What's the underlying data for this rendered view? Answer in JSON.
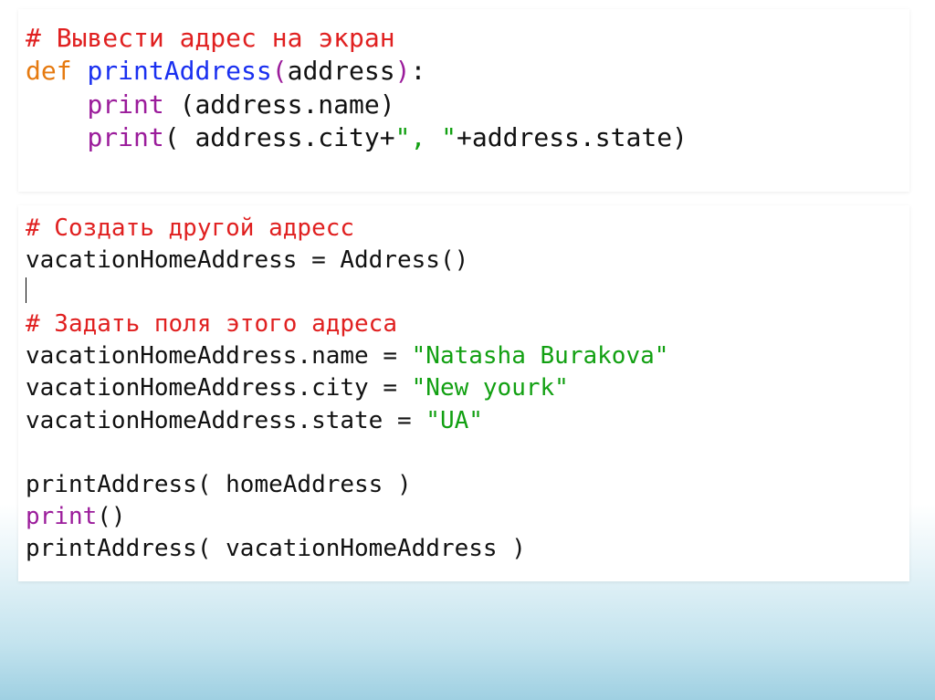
{
  "block1": {
    "comment": "# Вывести адрес на экран",
    "def": "def",
    "fname": "printAddress",
    "arg": "address",
    "lp": "(",
    "rp": ")",
    "colon": ":",
    "print": "print",
    "aname": " (address.name)",
    "l4_pre": "( address.city+",
    "l4_str": "\", \"",
    "l4_post": "+address.state)"
  },
  "block2": {
    "c1": "# Создать другой адресс",
    "l2": "vacationHomeAddress = Address()",
    "c2": "# Задать поля этого адреса",
    "l5_pre": "vacationHomeAddress.name = ",
    "l5_str": "\"Natasha Burakova\"",
    "l6_pre": "vacationHomeAddress.city = ",
    "l6_str": "\"New yourk\"",
    "l7_pre": "vacationHomeAddress.state = ",
    "l7_str": "\"UA\"",
    "l9": "printAddress( homeAddress )",
    "l10_print": "print",
    "l10_parens": "()",
    "l11": "printAddress( vacationHomeAddress )"
  }
}
